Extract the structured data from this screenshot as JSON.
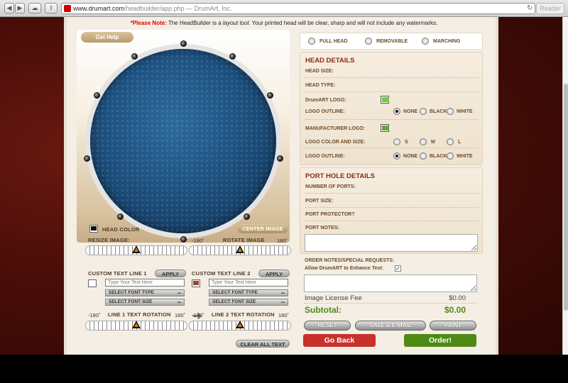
{
  "browser": {
    "url_domain": "www.drumart.com",
    "url_path": "/headbuilder/app.php",
    "page_title": " — DrumArt, Inc.",
    "reader_label": "Reader",
    "reload_glyph": "↻"
  },
  "note": {
    "prefix": "*Please Note:",
    "text_a": " The HeadBuilder is a ",
    "italic": "layout tool",
    "text_b": ". Your printed head will be clear, sharp and will not include any watermarks."
  },
  "left": {
    "get_help": "Get Help",
    "head_color_label": "HEAD COLOR",
    "center_image": "CENTER IMAGE",
    "resize_label": "RESIZE IMAGE:",
    "rotate_label": "ROTATE IMAGE",
    "rotate_min": "-180˚",
    "rotate_max": "180˚",
    "resize_value": 0.5,
    "rotate_value": 0.5,
    "text1": {
      "label": "CUSTOM TEXT LINE 1",
      "apply": "APPLY",
      "placeholder": "Type Your Text Here",
      "font_type": "SELECT FONT TYPE",
      "font_size": "SELECT FONT SIZE",
      "rotation_label": "LINE 1 TEXT ROTATION",
      "rot_min": "-180˚",
      "rot_max": "180˚",
      "color": "#ffffff"
    },
    "text2": {
      "label": "CUSTOM TEXT LINE 2",
      "apply": "APPLY",
      "placeholder": "Type Your Text Here",
      "font_type": "SELECT FONT TYPE",
      "font_size": "SELECT FONT SIZE",
      "rotation_label": "LINE 2 TEXT ROTATION",
      "rot_min": "-180˚",
      "rot_max": "180˚",
      "color": "#a2461d"
    },
    "clear_all": "CLEAR ALL TEXT",
    "head_color": "#111111"
  },
  "head_type": {
    "options": [
      "FULL HEAD",
      "REMOVABLE",
      "MARCHING"
    ]
  },
  "head_details": {
    "title": "HEAD DETAILS",
    "head_size": "HEAD SIZE:",
    "head_type": "HEAD TYPE:",
    "drumart_logo": "DrumART LOGO:",
    "drumart_logo_color": "#6cd23c",
    "logo_outline": "LOGO OUTLINE:",
    "outline_options": [
      "NONE",
      "BLACK",
      "WHITE"
    ],
    "manufacturer_logo": "MANUFACTURER LOGO:",
    "manufacturer_logo_color": "#6fa33c",
    "logo_color_size": "LOGO COLOR AND SIZE:",
    "size_options": [
      "S",
      "M",
      "L"
    ],
    "logo_outline_2": "LOGO OUTLINE:"
  },
  "port_details": {
    "title": "PORT HOLE DETAILS",
    "number_of_ports": "NUMBER OF PORTS:",
    "port_size": "PORT SIZE:",
    "port_protector": "PORT PROTECTOR?",
    "port_notes": "PORT NOTES:"
  },
  "order": {
    "notes_label": "ORDER NOTES/SPECIAL REQUESTS:",
    "enhance_label": "Allow DrumART to Enhance Text:",
    "image_fee_label": "Image License Fee",
    "image_fee_value": "$0.00",
    "subtotal_label": "Subtotal:",
    "subtotal_value": "$0.00",
    "reset": "RESET",
    "save_email": "SAVE & E-MAIL",
    "print": "PRINT",
    "go_back": "Go Back",
    "order": "Order!"
  },
  "colors": {
    "go_back": "#c8302a",
    "order": "#4f8a14",
    "section_title": "#8a2b12"
  }
}
